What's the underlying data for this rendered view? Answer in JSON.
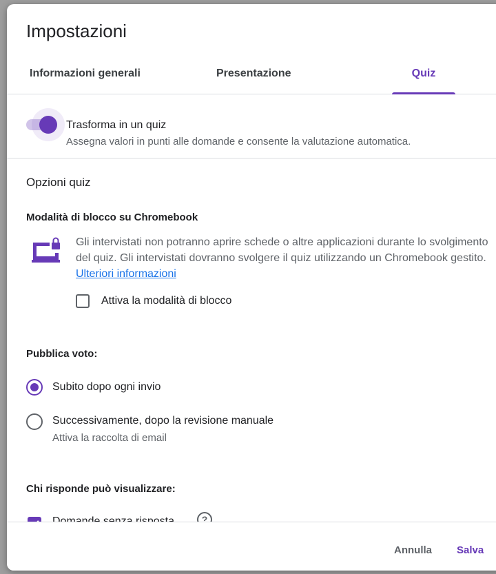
{
  "dialog": {
    "title": "Impostazioni"
  },
  "tabs": [
    {
      "label": "Informazioni generali"
    },
    {
      "label": "Presentazione"
    },
    {
      "label": "Quiz",
      "selected": true
    }
  ],
  "quiz_toggle": {
    "label": "Trasforma in un quiz",
    "description": "Assegna valori in punti alle domande e consente la valutazione automatica.",
    "on": true
  },
  "options": {
    "title": "Opzioni quiz",
    "lock_mode": {
      "heading": "Modalità di blocco su Chromebook",
      "icon": "laptop-lock-icon",
      "description": "Gli intervistati non potranno aprire schede o altre applicazioni durante lo svolgimento del quiz. Gli intervistati dovranno svolgere il quiz utilizzando un Chromebook gestito.",
      "link": "Ulteriori informazioni",
      "checkbox_label": "Attiva la modalità di blocco",
      "checkbox_checked": false
    },
    "release_grade": {
      "heading": "Pubblica voto:",
      "options": [
        {
          "label": "Subito dopo ogni invio",
          "selected": true
        },
        {
          "label": "Successivamente, dopo la revisione manuale",
          "sublabel": "Attiva la raccolta di email",
          "selected": false
        }
      ]
    },
    "respondent_view": {
      "heading": "Chi risponde può visualizzare:",
      "items": [
        {
          "label": "Domande senza risposta",
          "checked": true
        }
      ]
    }
  },
  "footer": {
    "cancel_label": "Annulla",
    "save_label": "Salva"
  },
  "colors": {
    "accent": "#673ab7",
    "link": "#1a73e8"
  }
}
